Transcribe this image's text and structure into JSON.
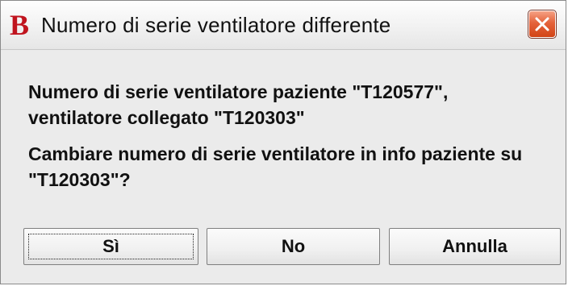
{
  "window": {
    "logo_letter": "B",
    "title": "Numero di serie ventilatore differente",
    "close_icon": "close-icon"
  },
  "message": {
    "line1": "Numero di serie ventilatore paziente \"T120577\",",
    "line2": "ventilatore collegato \"T120303\"",
    "line3": "Cambiare numero di serie ventilatore in info paziente su",
    "line4": "\"T120303\"?"
  },
  "buttons": {
    "yes": "Sì",
    "no": "No",
    "cancel": "Annulla"
  },
  "colors": {
    "logo": "#c0141e",
    "close_button": "#e4623a",
    "dialog_background": "#ebebeb"
  }
}
